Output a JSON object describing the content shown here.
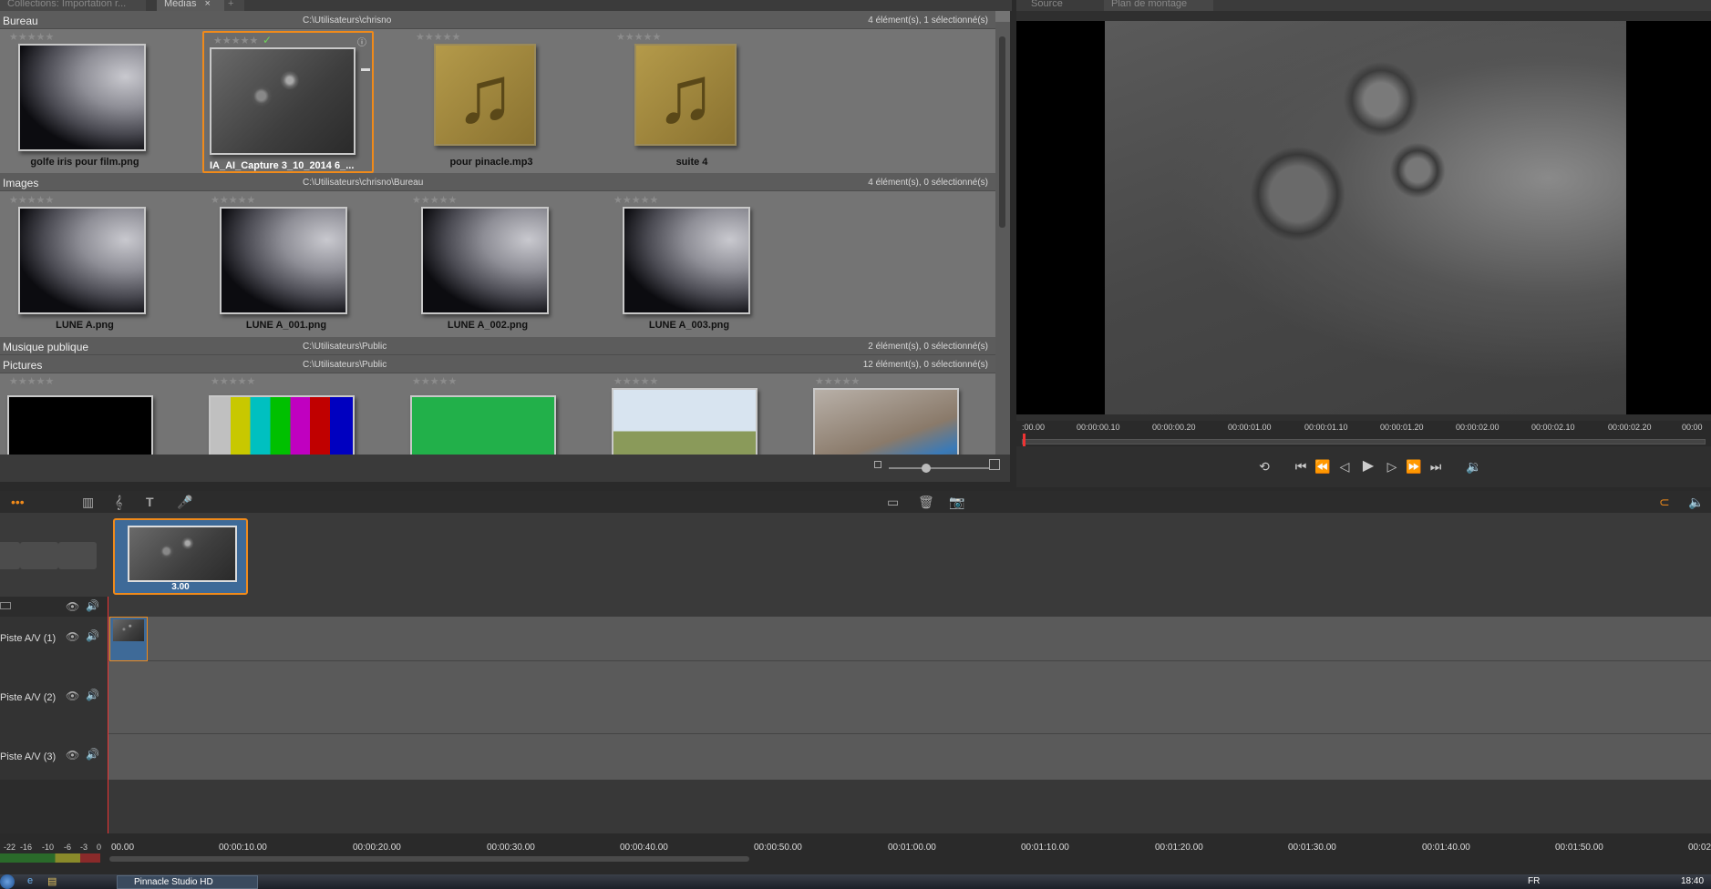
{
  "tabs": {
    "collections": "Collections: Importation r...",
    "medias": "Médias",
    "close_symbol": "×",
    "add_symbol": "+"
  },
  "player_tabs": {
    "source": "Source",
    "plan": "Plan de montage"
  },
  "library": {
    "sections": [
      {
        "name": "Bureau",
        "path": "C:\\Utilisateurs\\chrisno",
        "count": "4 élément(s), 1 sélectionné(s)"
      },
      {
        "name": "Images",
        "path": "C:\\Utilisateurs\\chrisno\\Bureau",
        "count": "4 élément(s), 0 sélectionné(s)"
      },
      {
        "name": "Musique publique",
        "path": "C:\\Utilisateurs\\Public",
        "count": "2 élément(s), 0 sélectionné(s)"
      },
      {
        "name": "Pictures",
        "path": "C:\\Utilisateurs\\Public",
        "count": "12 élément(s), 0 sélectionné(s)"
      }
    ],
    "stars": "★★★★★",
    "bureau_items": [
      "golfe iris pour film.png",
      "IA_AI_Capture 3_10_2014 6_...",
      "pour pinacle.mp3",
      "suite 4"
    ],
    "images_items": [
      "LUNE A.png",
      "LUNE A_001.png",
      "LUNE A_002.png",
      "LUNE A_003.png"
    ]
  },
  "player": {
    "ruler": [
      ":00.00",
      "00:00:00.10",
      "00:00:00.20",
      "00:00:01.00",
      "00:00:01.10",
      "00:00:01.20",
      "00:00:02.00",
      "00:00:02.10",
      "00:00:02.20",
      "00:00"
    ]
  },
  "storyboard": {
    "clip_duration": "3.00"
  },
  "tracks": [
    {
      "name": "Piste A/V (1)"
    },
    {
      "name": "Piste A/V (2)"
    },
    {
      "name": "Piste A/V (3)"
    }
  ],
  "timeline_ruler": [
    "00.00",
    "00:00:10.00",
    "00:00:20.00",
    "00:00:30.00",
    "00:00:40.00",
    "00:00:50.00",
    "00:01:00.00",
    "00:01:10.00",
    "00:01:20.00",
    "00:01:30.00",
    "00:01:40.00",
    "00:01:50.00",
    "00:02"
  ],
  "meter": [
    "-22",
    "-16",
    "-10",
    "-6",
    "-3",
    "0"
  ],
  "taskbar": {
    "app": "Pinnacle Studio HD",
    "lang": "FR",
    "clock": "18:40"
  }
}
